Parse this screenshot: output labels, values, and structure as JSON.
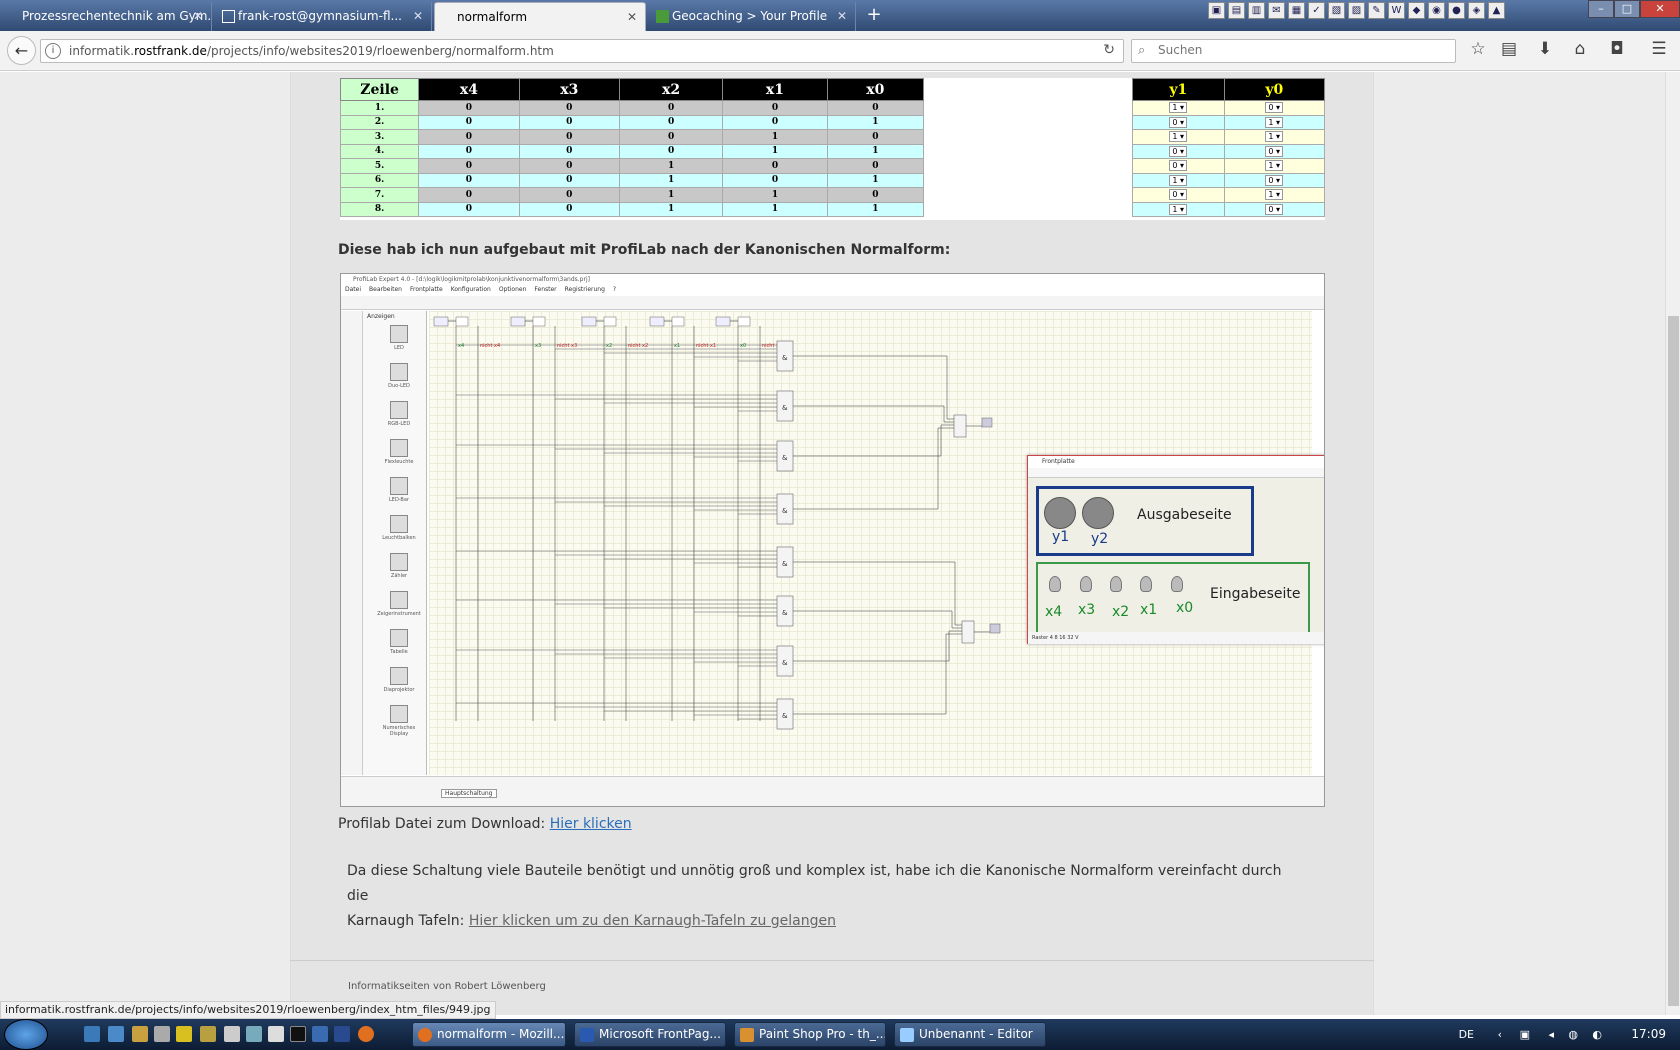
{
  "browser": {
    "tabs": [
      {
        "label": "Prozessrechentechnik am Gym...",
        "active": false
      },
      {
        "label": "frank-rost@gymnasium-fl...",
        "active": false
      },
      {
        "label": "normalform",
        "active": true
      },
      {
        "label": "Geocaching > Your Profile",
        "active": false
      }
    ],
    "url_prefix": "informatik.",
    "url_domain": "rostfrank.de",
    "url_path": "/projects/info/websites2019/rloewenberg/normalform.htm",
    "search_placeholder": "Suchen",
    "status_url": "informatik.rostfrank.de/projects/info/websites2019/rloewenberg/index_htm_files/949.jpg"
  },
  "truth_table": {
    "headers": [
      "Zeile",
      "x4",
      "x3",
      "x2",
      "x1",
      "x0"
    ],
    "out_headers": [
      "y1",
      "y0"
    ],
    "rows": [
      {
        "z": "1.",
        "x": [
          "0",
          "0",
          "0",
          "0",
          "0"
        ],
        "y": [
          "1",
          "0"
        ]
      },
      {
        "z": "2.",
        "x": [
          "0",
          "0",
          "0",
          "0",
          "1"
        ],
        "y": [
          "0",
          "1"
        ]
      },
      {
        "z": "3.",
        "x": [
          "0",
          "0",
          "0",
          "1",
          "0"
        ],
        "y": [
          "1",
          "1"
        ]
      },
      {
        "z": "4.",
        "x": [
          "0",
          "0",
          "0",
          "1",
          "1"
        ],
        "y": [
          "0",
          "0"
        ]
      },
      {
        "z": "5.",
        "x": [
          "0",
          "0",
          "1",
          "0",
          "0"
        ],
        "y": [
          "0",
          "1"
        ]
      },
      {
        "z": "6.",
        "x": [
          "0",
          "0",
          "1",
          "0",
          "1"
        ],
        "y": [
          "1",
          "0"
        ]
      },
      {
        "z": "7.",
        "x": [
          "0",
          "0",
          "1",
          "1",
          "0"
        ],
        "y": [
          "0",
          "1"
        ]
      },
      {
        "z": "8.",
        "x": [
          "0",
          "0",
          "1",
          "1",
          "1"
        ],
        "y": [
          "1",
          "0"
        ]
      }
    ]
  },
  "text": {
    "intro": "Diese hab ich nun aufgebaut mit ProfiLab nach der Kanonischen Normalform:",
    "download_prefix": "Profilab Datei zum Download: ",
    "download_link": "Hier klicken ",
    "para_line1": "Da diese Schaltung viele Bauteile benötigt und unnötig groß und komplex ist, habe ich die Kanonische Normalform vereinfacht durch die",
    "para_line2_prefix": "Karnaugh Tafeln: ",
    "para_link": "Hier klicken um zu den Karnaugh-Tafeln zu gelangen",
    "footer": "Informatikseiten von Robert Löwenberg"
  },
  "profilab": {
    "title": "ProfiLab Expert 4.0 - [d:\\logik\\logikmitprolab\\konjunktivenormalform\\3ands.prj]",
    "menu": [
      "Datei",
      "Bearbeiten",
      "Frontplatte",
      "Konfiguration",
      "Optionen",
      "Fenster",
      "Registrierung",
      "?"
    ],
    "palette_header": "Anzeigen",
    "palette": [
      "LED",
      "Duo-LED",
      "RGB-LED",
      "Flexleuchte",
      "LED-Bar",
      "Leuchtbalken",
      "Zähler",
      "Zeigerinstrument",
      "Tabelle",
      "Diaprojektor",
      "Numerisches Display"
    ],
    "inputs": [
      "x4",
      "x3",
      "x2",
      "x1",
      "x0"
    ],
    "inverted_inputs": [
      "nicht x4",
      "nicht x3",
      "nicht x2",
      "nicht x1",
      "nicht x0"
    ],
    "sheet_tab": "Hauptschaltung",
    "frontplatte_title": "Frontplatte",
    "out_labels": [
      "y1",
      "y2"
    ],
    "ausgabe_label": "Ausgabeseite",
    "in_labels": [
      "x4",
      "x3",
      "x2",
      "x1",
      "x0"
    ],
    "eingabe_label": "Eingabeseite",
    "status": "Raster  4  8  16  32  V"
  },
  "taskbar": {
    "tasks": [
      {
        "label": "normalform - Mozill...",
        "active": true
      },
      {
        "label": "Microsoft FrontPag...",
        "active": false
      },
      {
        "label": "Paint Shop Pro - th_...",
        "active": false
      },
      {
        "label": "Unbenannt - Editor",
        "active": false
      }
    ],
    "lang": "DE",
    "time": "17:09"
  },
  "colors": {
    "tab_bar": "#3d5c8a",
    "link": "#2a6ebb",
    "zeile_bg": "#ccffcc",
    "row_gray": "#c8c8c8",
    "row_cyan": "#ccffff",
    "output_yellow": "#ffff00",
    "ausgabe_border": "#1a3a8a",
    "eingabe_border": "#3a9a4a"
  }
}
